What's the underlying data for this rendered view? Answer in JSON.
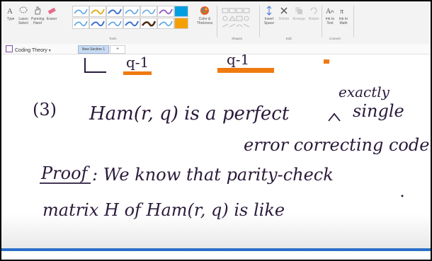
{
  "ribbon": {
    "tools": [
      {
        "name": "type-tool",
        "label": "Type"
      },
      {
        "name": "lasso-select-tool",
        "label": "Lasso Select"
      },
      {
        "name": "panning-hand-tool",
        "label": "Panning Hand"
      },
      {
        "name": "eraser-tool",
        "label": "Eraser"
      }
    ],
    "group_tools": "Tools",
    "color_thickness": "Color & Thickness",
    "group_shapes": "Shapes",
    "insert_space": "Insert Space",
    "delete": "Delete",
    "arrange": "Arrange",
    "rotate": "Rotate",
    "group_edit": "Edit",
    "ink_to_text": "Ink to Text",
    "ink_to_math": "Ink to Math",
    "group_convert": "Convert",
    "pen_colors": [
      "#4a9be0",
      "#e0b020",
      "#4a9be0",
      "#e0b020",
      "#3a6fd0",
      "#e0b020",
      "#4a9be0",
      "#5aa0e0",
      "#4a9be0",
      "#4a2a10",
      "#9a60c0",
      "#00a0e0"
    ]
  },
  "tabs": {
    "notebook": "Coding Theory",
    "section": "New Section 1",
    "add": "+"
  },
  "note": {
    "line_top_a": "q-1",
    "line_top_b": "q-1",
    "theorem_number": "(3)",
    "theorem_line1": "Ham(r, q)   is a   perfect",
    "insert_word": "exactly",
    "theorem_word": "single",
    "theorem_line2": "error correcting   code",
    "proof_label": "Proof",
    "proof_line1": ": We know that   parity-check",
    "proof_line2": "matrix  H  of  Ham(r, q)    is like"
  }
}
